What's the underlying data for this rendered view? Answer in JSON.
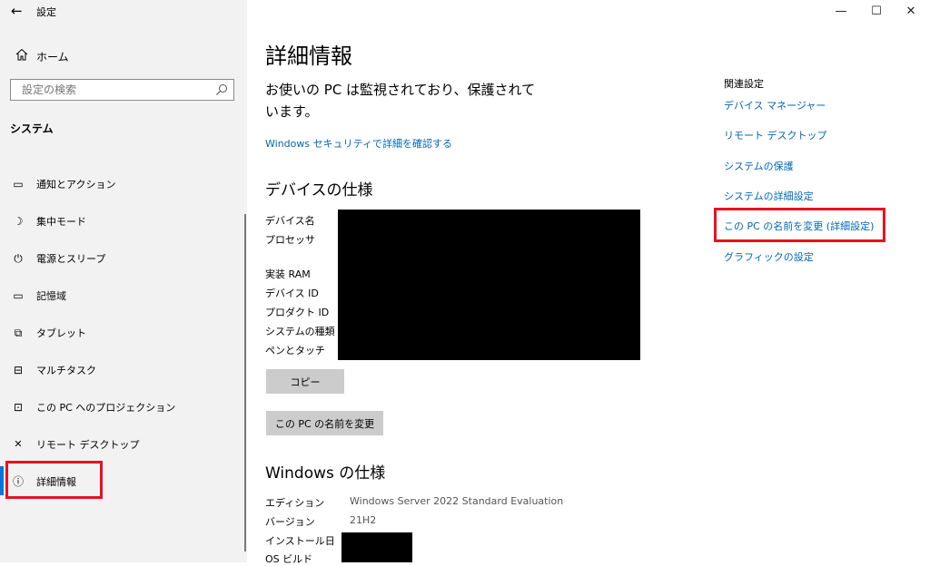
{
  "window": {
    "title": "設定",
    "controls": {
      "minimize": "—",
      "maximize": "☐",
      "close": "✕"
    }
  },
  "sidebar": {
    "back_glyph": "←",
    "home_label": "ホーム",
    "search": {
      "placeholder": "設定の検索"
    },
    "section_title": "システム",
    "items": [
      {
        "label": "通知とアクション",
        "icon": "notification-icon",
        "glyph": "▭"
      },
      {
        "label": "集中モード",
        "icon": "moon-icon",
        "glyph": "☽"
      },
      {
        "label": "電源とスリープ",
        "icon": "power-icon",
        "glyph": "⏻"
      },
      {
        "label": "記憶域",
        "icon": "storage-icon",
        "glyph": "▭"
      },
      {
        "label": "タブレット",
        "icon": "tablet-icon",
        "glyph": "⧉"
      },
      {
        "label": "マルチタスク",
        "icon": "multitask-icon",
        "glyph": "⊟"
      },
      {
        "label": "この PC へのプロジェクション",
        "icon": "projection-icon",
        "glyph": "⊡"
      },
      {
        "label": "リモート デスクトップ",
        "icon": "remote-desktop-icon",
        "glyph": "✕"
      },
      {
        "label": "詳細情報",
        "icon": "info-icon",
        "glyph": "ⓘ",
        "selected": true
      }
    ]
  },
  "main": {
    "title": "詳細情報",
    "warning_text": "お使いの PC は監視されており、保護されています。",
    "security_link": "Windows セキュリティで詳細を確認する",
    "device_specs": {
      "heading": "デバイスの仕様",
      "labels": [
        "デバイス名",
        "プロセッサ",
        "実装 RAM",
        "デバイス ID",
        "プロダクト ID",
        "システムの種類",
        "ペンとタッチ"
      ],
      "copy_button": "コピー",
      "rename_button": "この PC の名前を変更"
    },
    "windows_specs": {
      "heading": "Windows の仕様",
      "rows": [
        {
          "label": "エディション",
          "value": "Windows Server 2022 Standard Evaluation"
        },
        {
          "label": "バージョン",
          "value": "21H2"
        },
        {
          "label": "インストール日",
          "value": ""
        },
        {
          "label": "OS ビルド",
          "value": ""
        }
      ]
    }
  },
  "related": {
    "title": "関連設定",
    "links": [
      {
        "label": "デバイス マネージャー"
      },
      {
        "label": "リモート デスクトップ"
      },
      {
        "label": "システムの保護"
      },
      {
        "label": "システムの詳細設定"
      },
      {
        "label": "この PC の名前を変更 (詳細設定)"
      },
      {
        "label": "グラフィックの設定"
      }
    ]
  },
  "colors": {
    "accent": "#0078d7",
    "link": "#0067b8",
    "highlight": "#e81123",
    "sidebar_bg": "#f2f2f2"
  }
}
